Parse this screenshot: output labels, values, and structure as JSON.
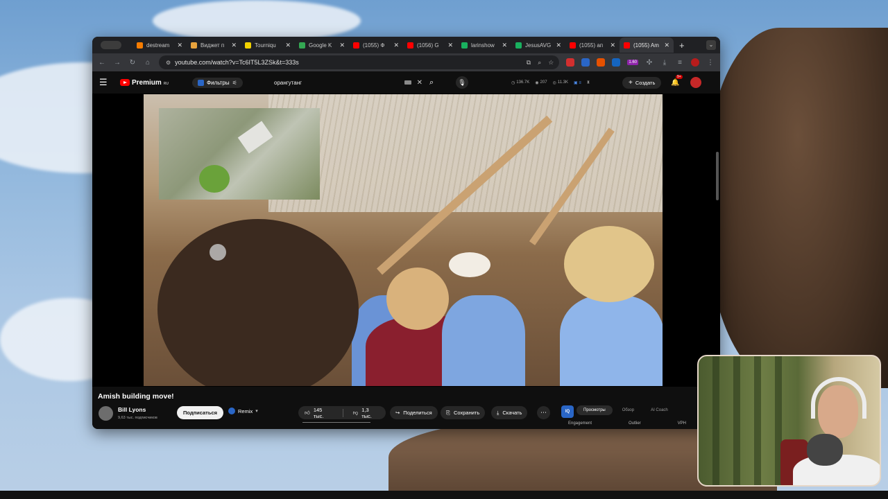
{
  "browser": {
    "tabs": [
      {
        "title": "destream",
        "color": "#f57c00",
        "active": false
      },
      {
        "title": "Виджет п",
        "color": "#e8a33d",
        "active": false
      },
      {
        "title": "Tourniqu",
        "color": "#f2d200",
        "active": false
      },
      {
        "title": "Google K",
        "color": "#34a853",
        "active": false
      },
      {
        "title": "(1055) Ф",
        "color": "#ff0000",
        "active": false
      },
      {
        "title": "(1056) G",
        "color": "#ff0000",
        "active": false
      },
      {
        "title": "larinshow",
        "color": "#19b05f",
        "active": false
      },
      {
        "title": "JesusAVG",
        "color": "#19b05f",
        "active": false
      },
      {
        "title": "(1055) ап",
        "color": "#ff0000",
        "active": false
      },
      {
        "title": "(1055) Am",
        "color": "#ff0000",
        "active": true
      }
    ],
    "new_tab": "+",
    "url": "youtube.com/watch?v=Tc6IT5L3ZSk&t=333s",
    "ext_badge": "1.60"
  },
  "youtube": {
    "logo_text": "Premium",
    "logo_sup": "RU",
    "filters_label": "Фильтры",
    "search_value": "орангутанг",
    "stats": {
      "views": "136.7K",
      "count": "207",
      "likes": "11.3K"
    },
    "create_label": "Создать",
    "notif_count": "9+"
  },
  "video": {
    "title": "Amish building move!",
    "channel": "Bill Lyons",
    "subscribers": "9,63 тыс. подписчиков",
    "subscribe_label": "Подписаться",
    "remix_label": "Remix",
    "likes": "145 тыс.",
    "dislikes": "1,3 тыс.",
    "share_label": "Поделиться",
    "save_label": "Сохранить",
    "download_label": "Скачать"
  },
  "vidiq": {
    "icon_label": "IQ",
    "tabs": [
      "Просмотры",
      "Обзор",
      "AI Coach"
    ],
    "metrics": [
      "Engagement",
      "Outlier",
      "VPH"
    ]
  }
}
